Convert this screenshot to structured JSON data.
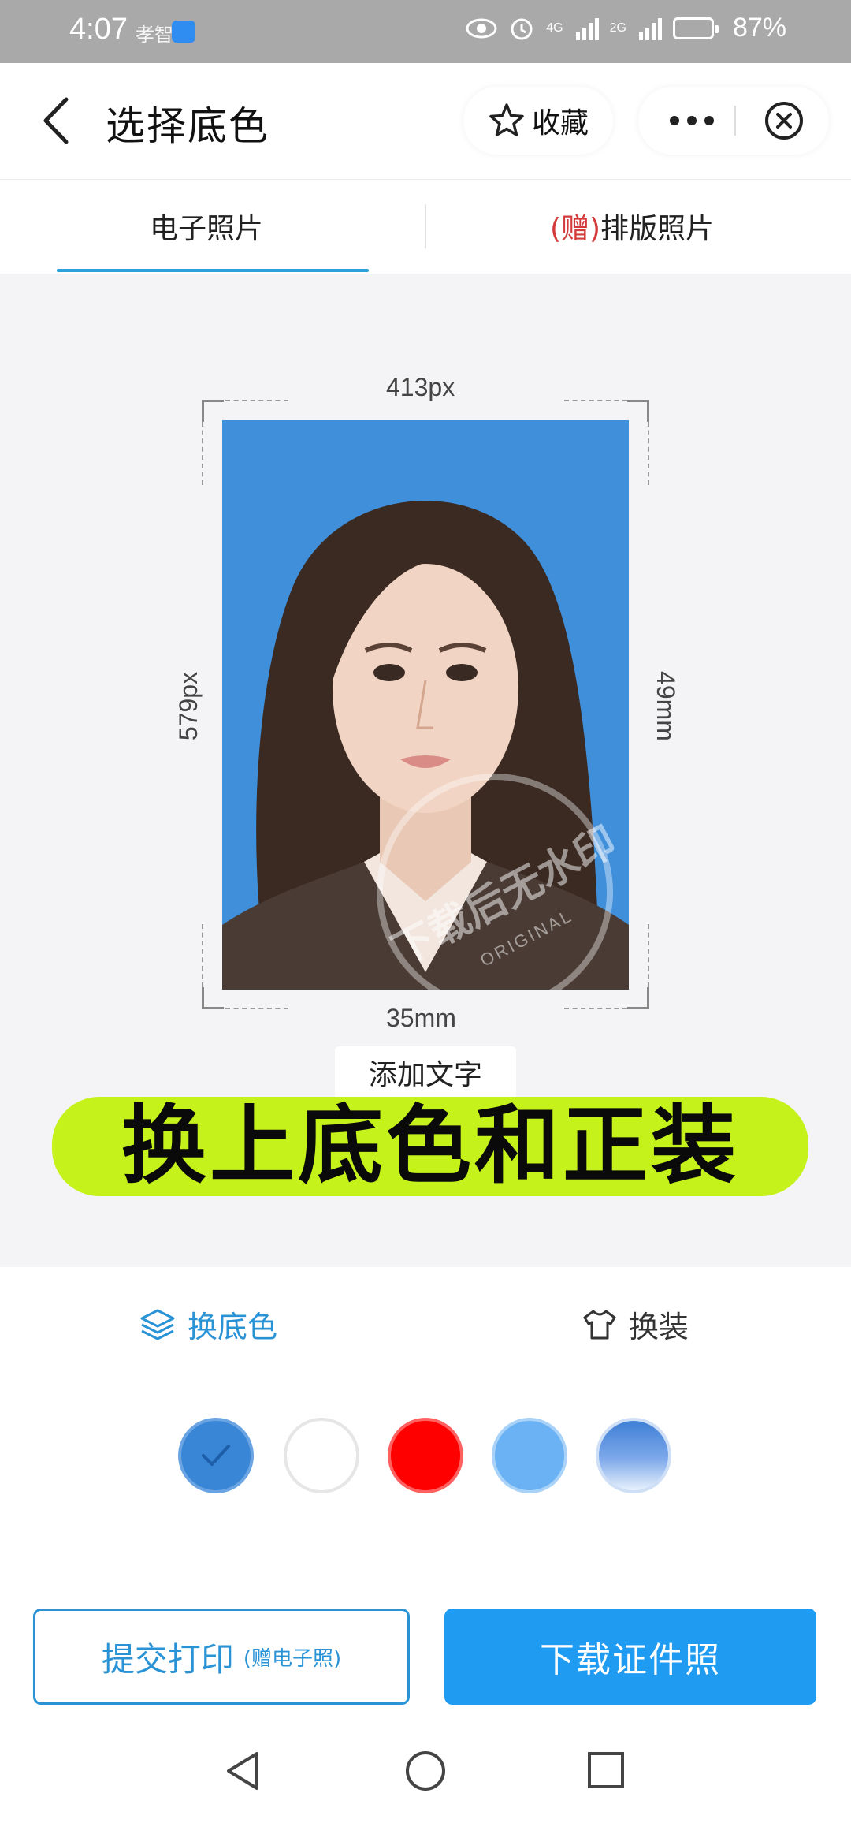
{
  "status_bar": {
    "time": "4:07",
    "carrier_note": "孝智",
    "network_1": "4G",
    "network_2": "2G",
    "battery": "87%"
  },
  "header": {
    "title": "选择底色",
    "favorite_label": "收藏",
    "more_icon": "more-icon",
    "close_icon": "close-icon"
  },
  "tabs": [
    {
      "label": "电子照片",
      "active": true
    },
    {
      "gift": "(赠)",
      "label": "排版照片",
      "active": false
    }
  ],
  "preview": {
    "width_px": "413px",
    "height_px": "579px",
    "width_mm": "35mm",
    "height_mm": "49mm",
    "background_color": "#3f8fdb",
    "watermark_text": "下载后无水印",
    "watermark_sub": "ORIGINAL",
    "add_text_label": "添加文字",
    "banner_text": "换上底色和正装"
  },
  "options": {
    "change_bg_label": "换底色",
    "change_clothes_label": "换装",
    "swatches": [
      {
        "name": "dark-blue",
        "color": "#3a86d6",
        "selected": true
      },
      {
        "name": "white",
        "color": "#ffffff",
        "selected": false
      },
      {
        "name": "red",
        "color": "#ff0000",
        "selected": false
      },
      {
        "name": "light-blue",
        "color": "#6ab2f4",
        "selected": false
      },
      {
        "name": "gradient-blue",
        "color": "#4c8fe0",
        "selected": false
      }
    ]
  },
  "actions": {
    "print_label": "提交打印",
    "print_sub": "(赠电子照)",
    "download_label": "下载证件照"
  },
  "colors": {
    "accent": "#2a93d6",
    "primary_button": "#1f9bf2",
    "banner": "#c6f21c"
  }
}
